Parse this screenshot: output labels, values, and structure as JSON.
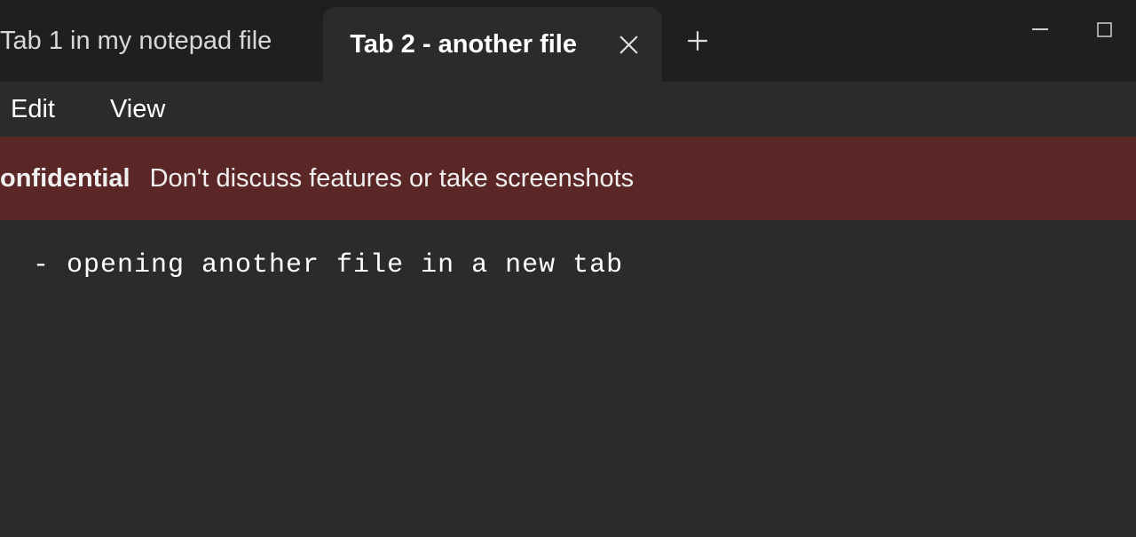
{
  "tabs": [
    {
      "label": "Tab 1 in my notepad file",
      "active": false
    },
    {
      "label": "Tab 2 - another file",
      "active": true
    }
  ],
  "menu": {
    "edit": "Edit",
    "view": "View"
  },
  "banner": {
    "label": "onfidential",
    "text": "Don't discuss features or take screenshots"
  },
  "editor": {
    "content": " - opening another file in a new tab"
  }
}
